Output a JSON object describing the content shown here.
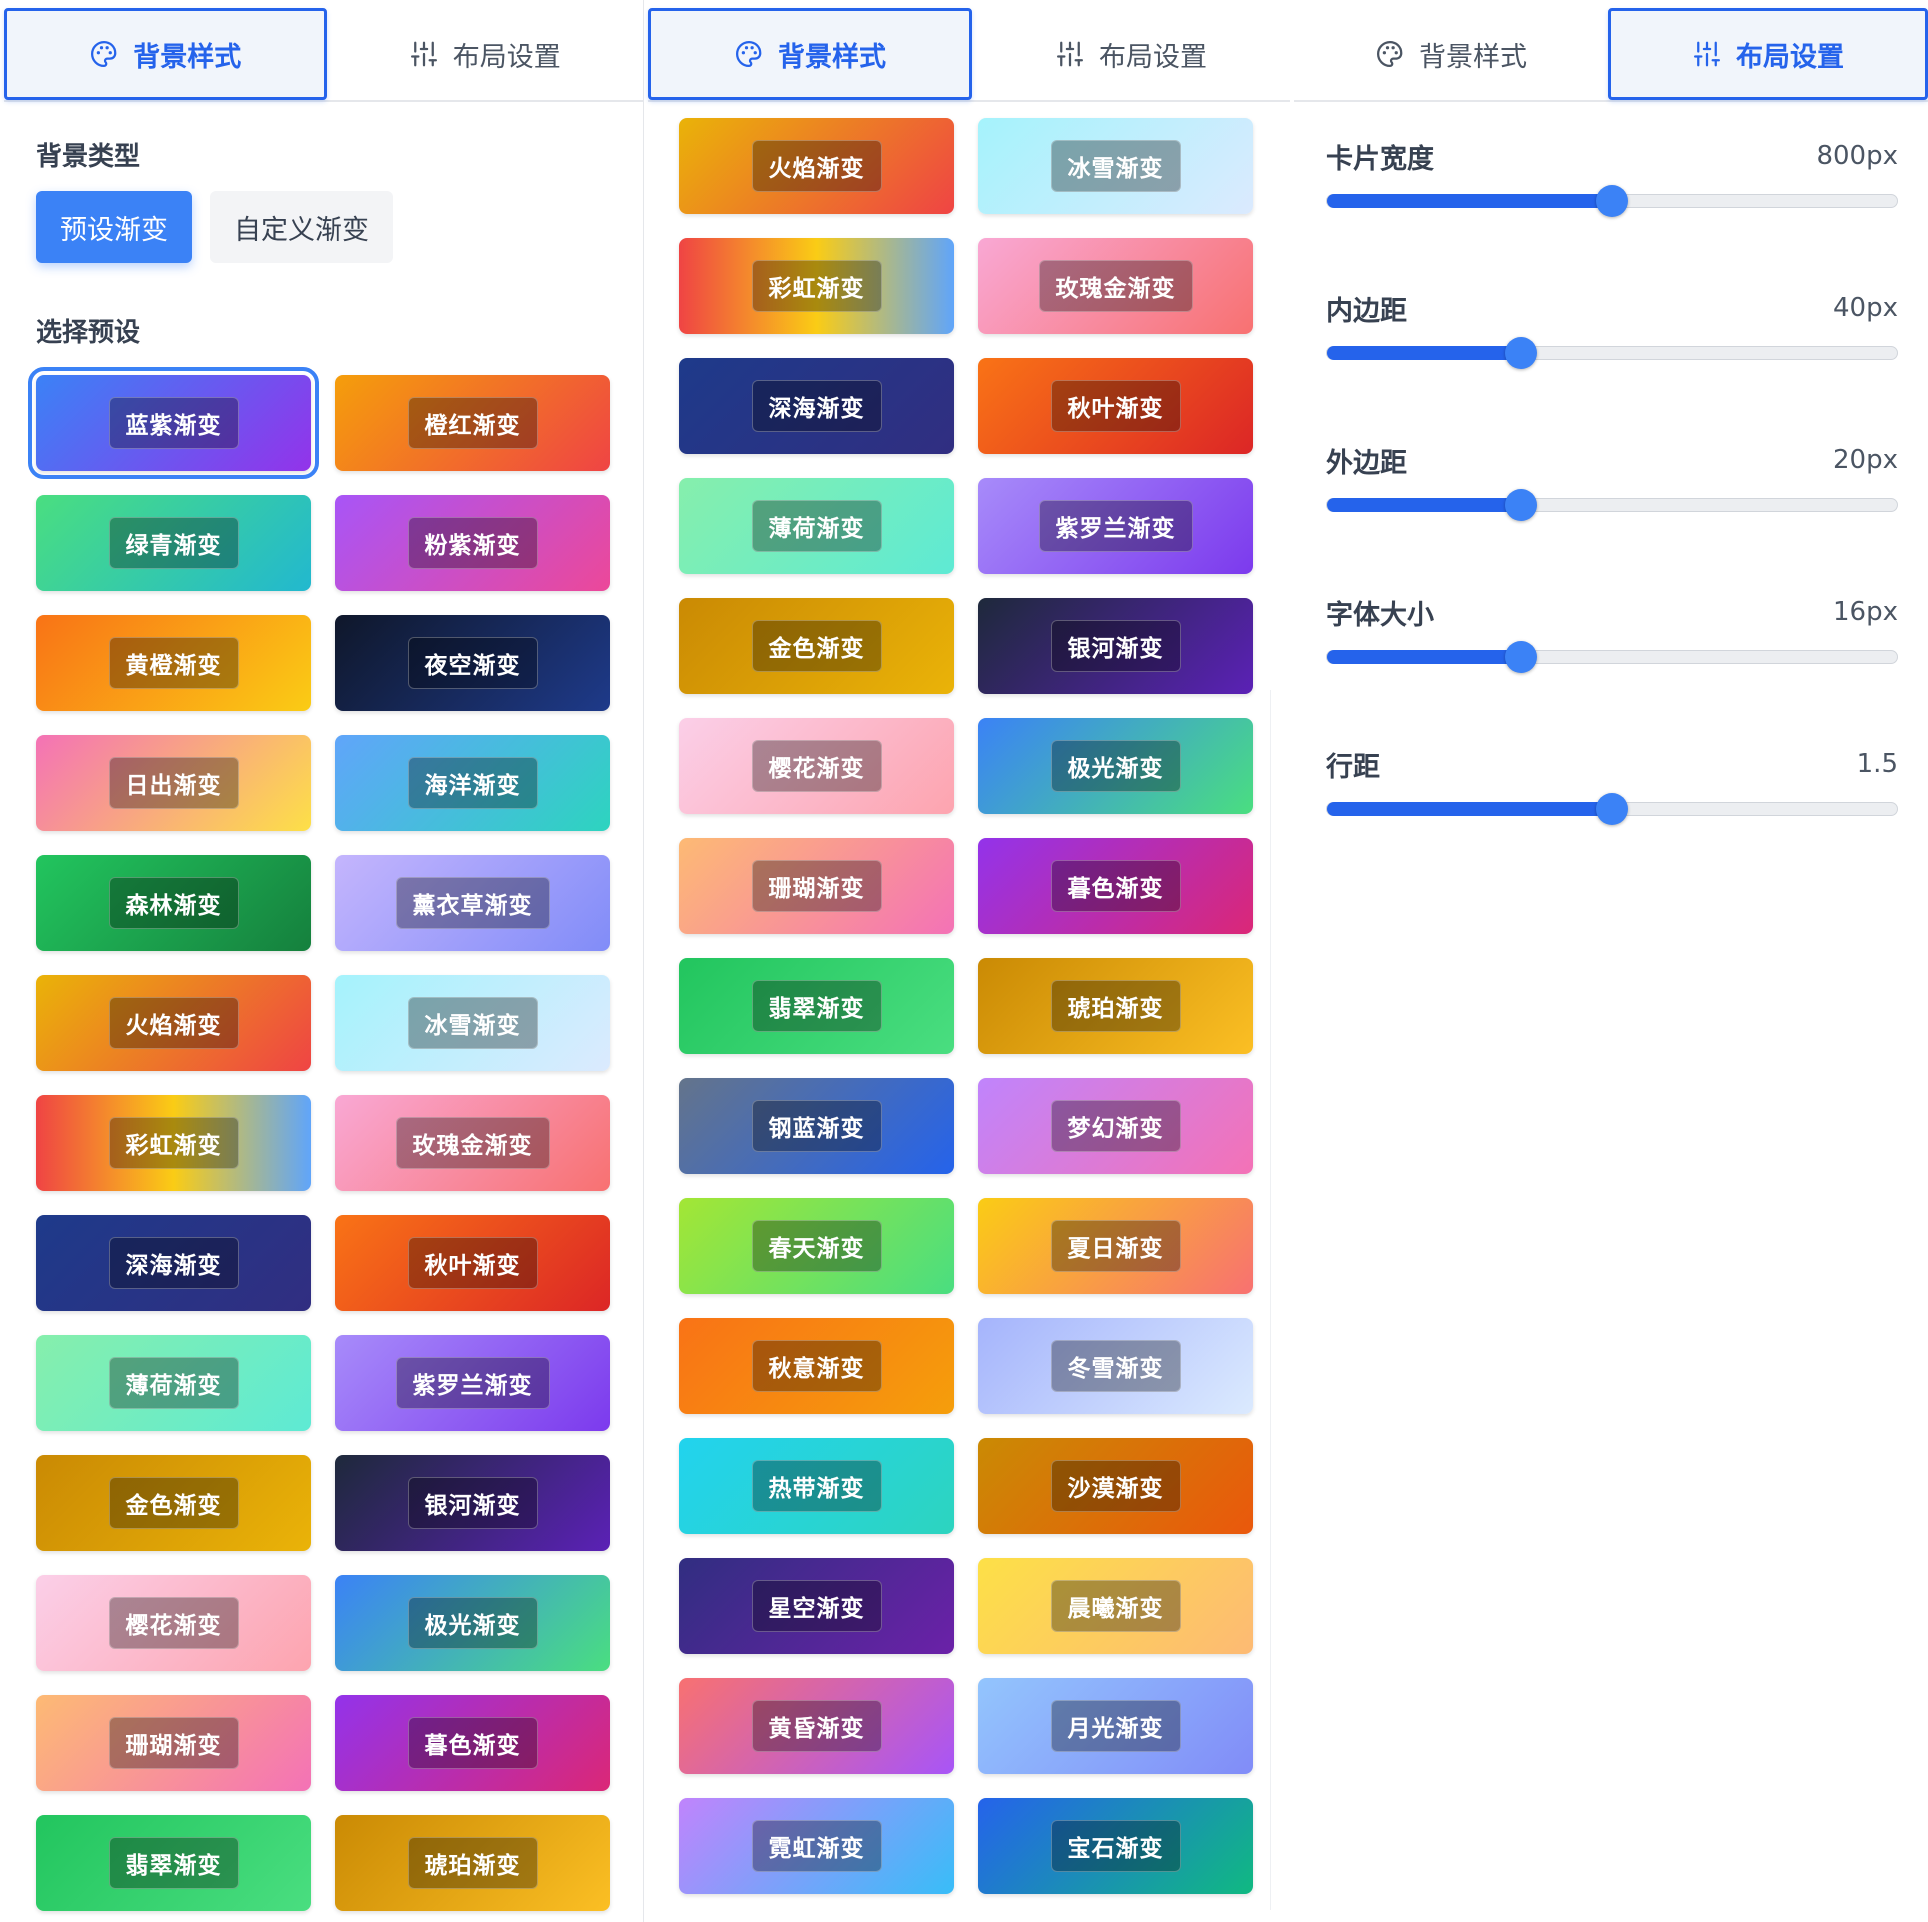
{
  "tabs": {
    "background": "背景样式",
    "layout": "布局设置"
  },
  "panel1": {
    "bg_type_label": "背景类型",
    "type_buttons": [
      "预设渐变",
      "自定义渐变"
    ],
    "select_preset_label": "选择预设"
  },
  "presets": [
    {
      "name": "蓝紫渐变",
      "from": "#3b82f6",
      "to": "#9333ea"
    },
    {
      "name": "橙红渐变",
      "from": "#f59e0b",
      "to": "#ef4444"
    },
    {
      "name": "绿青渐变",
      "from": "#4ade80",
      "to": "#22b8cf"
    },
    {
      "name": "粉紫渐变",
      "from": "#a855f7",
      "to": "#ec4899"
    },
    {
      "name": "黄橙渐变",
      "from": "#f97316",
      "to": "#facc15"
    },
    {
      "name": "夜空渐变",
      "from": "#0f172a",
      "to": "#1e3a8a"
    },
    {
      "name": "日出渐变",
      "from": "#f472b6",
      "to": "#fde047"
    },
    {
      "name": "海洋渐变",
      "from": "#60a5fa",
      "to": "#2dd4bf"
    },
    {
      "name": "森林渐变",
      "from": "#22c55e",
      "to": "#15803d"
    },
    {
      "name": "薰衣草渐变",
      "from": "#c4b5fd",
      "to": "#818cf8"
    },
    {
      "name": "火焰渐变",
      "from": "#eab308",
      "to": "#ef4444"
    },
    {
      "name": "冰雪渐变",
      "from": "#a5f3fc",
      "to": "#dbeafe"
    },
    {
      "name": "彩虹渐变",
      "from": "#ef4444",
      "mid": "#facc15",
      "to": "#60a5fa"
    },
    {
      "name": "玫瑰金渐变",
      "from": "#f9a8d4",
      "to": "#f87171"
    },
    {
      "name": "深海渐变",
      "from": "#1e3a8a",
      "to": "#312e81"
    },
    {
      "name": "秋叶渐变",
      "from": "#f97316",
      "to": "#dc2626"
    },
    {
      "name": "薄荷渐变",
      "from": "#86efac",
      "to": "#5eead4"
    },
    {
      "name": "紫罗兰渐变",
      "from": "#a78bfa",
      "to": "#7c3aed"
    },
    {
      "name": "金色渐变",
      "from": "#ca8a04",
      "to": "#eab308"
    },
    {
      "name": "银河渐变",
      "from": "#1e293b",
      "to": "#5b21b6"
    },
    {
      "name": "樱花渐变",
      "from": "#fbcfe8",
      "to": "#fda4af"
    },
    {
      "name": "极光渐变",
      "from": "#3b82f6",
      "to": "#4ade80"
    },
    {
      "name": "珊瑚渐变",
      "from": "#fdba74",
      "to": "#f472b6"
    },
    {
      "name": "暮色渐变",
      "from": "#9333ea",
      "to": "#db2777"
    },
    {
      "name": "翡翠渐变",
      "from": "#22c55e",
      "to": "#4ade80"
    },
    {
      "name": "琥珀渐变",
      "from": "#ca8a04",
      "to": "#fbbf24"
    },
    {
      "name": "钢蓝渐变",
      "from": "#64748b",
      "to": "#2563eb"
    },
    {
      "name": "梦幻渐变",
      "from": "#c084fc",
      "to": "#f472b6"
    },
    {
      "name": "春天渐变",
      "from": "#a3e635",
      "to": "#4ade80"
    },
    {
      "name": "夏日渐变",
      "from": "#facc15",
      "to": "#f87171"
    },
    {
      "name": "秋意渐变",
      "from": "#f97316",
      "to": "#f59e0b"
    },
    {
      "name": "冬雪渐变",
      "from": "#a5b4fc",
      "to": "#dbeafe"
    },
    {
      "name": "热带渐变",
      "from": "#22d3ee",
      "to": "#2dd4bf"
    },
    {
      "name": "沙漠渐变",
      "from": "#ca8a04",
      "to": "#ea580c"
    },
    {
      "name": "星空渐变",
      "from": "#312e81",
      "to": "#6b21a8"
    },
    {
      "name": "晨曦渐变",
      "from": "#fde047",
      "to": "#fdba74"
    },
    {
      "name": "黄昏渐变",
      "from": "#f87171",
      "to": "#a855f7"
    },
    {
      "name": "月光渐变",
      "from": "#93c5fd",
      "to": "#818cf8"
    },
    {
      "name": "霓虹渐变",
      "from": "#c084fc",
      "to": "#38bdf8"
    },
    {
      "name": "宝石渐变",
      "from": "#2563eb",
      "to": "#10b981"
    }
  ],
  "selected_preset": "蓝紫渐变",
  "panel1_visible_range": [
    0,
    26
  ],
  "panel2_visible_range": [
    10,
    40
  ],
  "layout": {
    "sliders": [
      {
        "key": "card_width",
        "label": "卡片宽度",
        "value": "800px",
        "fraction": 0.5
      },
      {
        "key": "padding",
        "label": "内边距",
        "value": "40px",
        "fraction": 0.34
      },
      {
        "key": "margin",
        "label": "外边距",
        "value": "20px",
        "fraction": 0.34
      },
      {
        "key": "font_size",
        "label": "字体大小",
        "value": "16px",
        "fraction": 0.34
      },
      {
        "key": "line_height",
        "label": "行距",
        "value": "1.5",
        "fraction": 0.5
      }
    ]
  },
  "colors": {
    "accent": "#2563eb",
    "accent_light": "#3b82f6"
  }
}
